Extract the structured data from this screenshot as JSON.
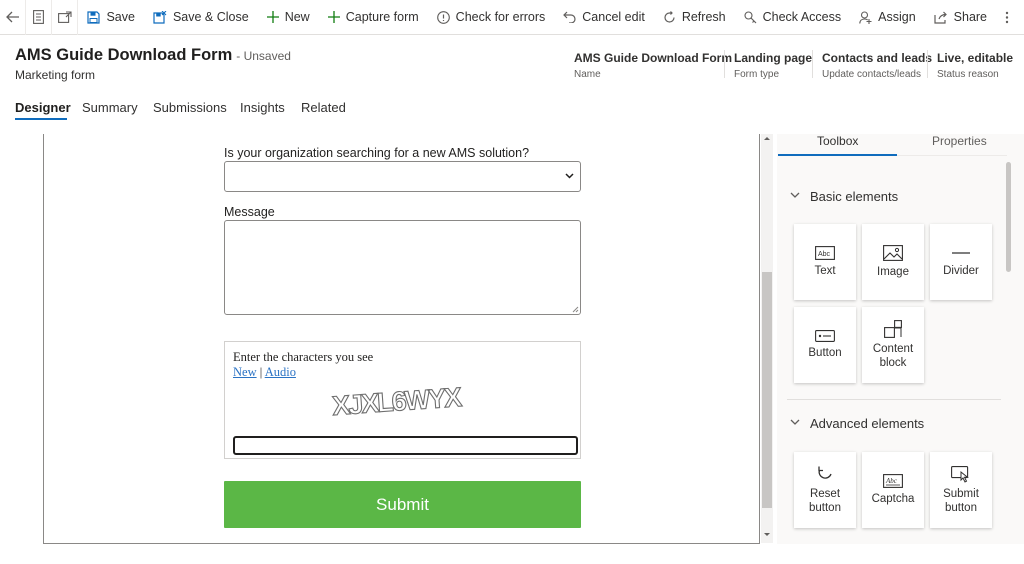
{
  "commandbar": {
    "save": "Save",
    "save_close": "Save & Close",
    "new": "New",
    "capture_form": "Capture form",
    "check_errors": "Check for errors",
    "cancel_edit": "Cancel edit",
    "refresh": "Refresh",
    "check_access": "Check Access",
    "assign": "Assign",
    "share": "Share"
  },
  "header": {
    "title": "AMS Guide Download Form",
    "unsaved": "- Unsaved",
    "subtitle": "Marketing form",
    "fields": [
      {
        "value": "AMS Guide Download Form",
        "label": "Name"
      },
      {
        "value": "Landing page",
        "label": "Form type"
      },
      {
        "value": "Contacts and leads",
        "label": "Update contacts/leads"
      },
      {
        "value": "Live, editable",
        "label": "Status reason"
      }
    ]
  },
  "tabs": [
    "Designer",
    "Summary",
    "Submissions",
    "Insights",
    "Related"
  ],
  "form": {
    "question_label": "Is your organization searching for a new AMS solution?",
    "question_value": "",
    "message_label": "Message",
    "captcha_prompt": "Enter the characters you see",
    "captcha_new": "New",
    "captcha_sep": "|",
    "captcha_audio": "Audio",
    "captcha_text": "XJXL6WYX",
    "submit": "Submit"
  },
  "toolbox": {
    "tab_toolbox": "Toolbox",
    "tab_properties": "Properties",
    "basic_title": "Basic elements",
    "basic_items": [
      "Text",
      "Image",
      "Divider",
      "Button",
      "Content block"
    ],
    "advanced_title": "Advanced elements",
    "advanced_items": [
      "Reset button",
      "Captcha",
      "Submit button"
    ]
  },
  "colors": {
    "accent": "#0f6cbd",
    "submit_button": "#5bb746",
    "link": "#2b73c4"
  }
}
